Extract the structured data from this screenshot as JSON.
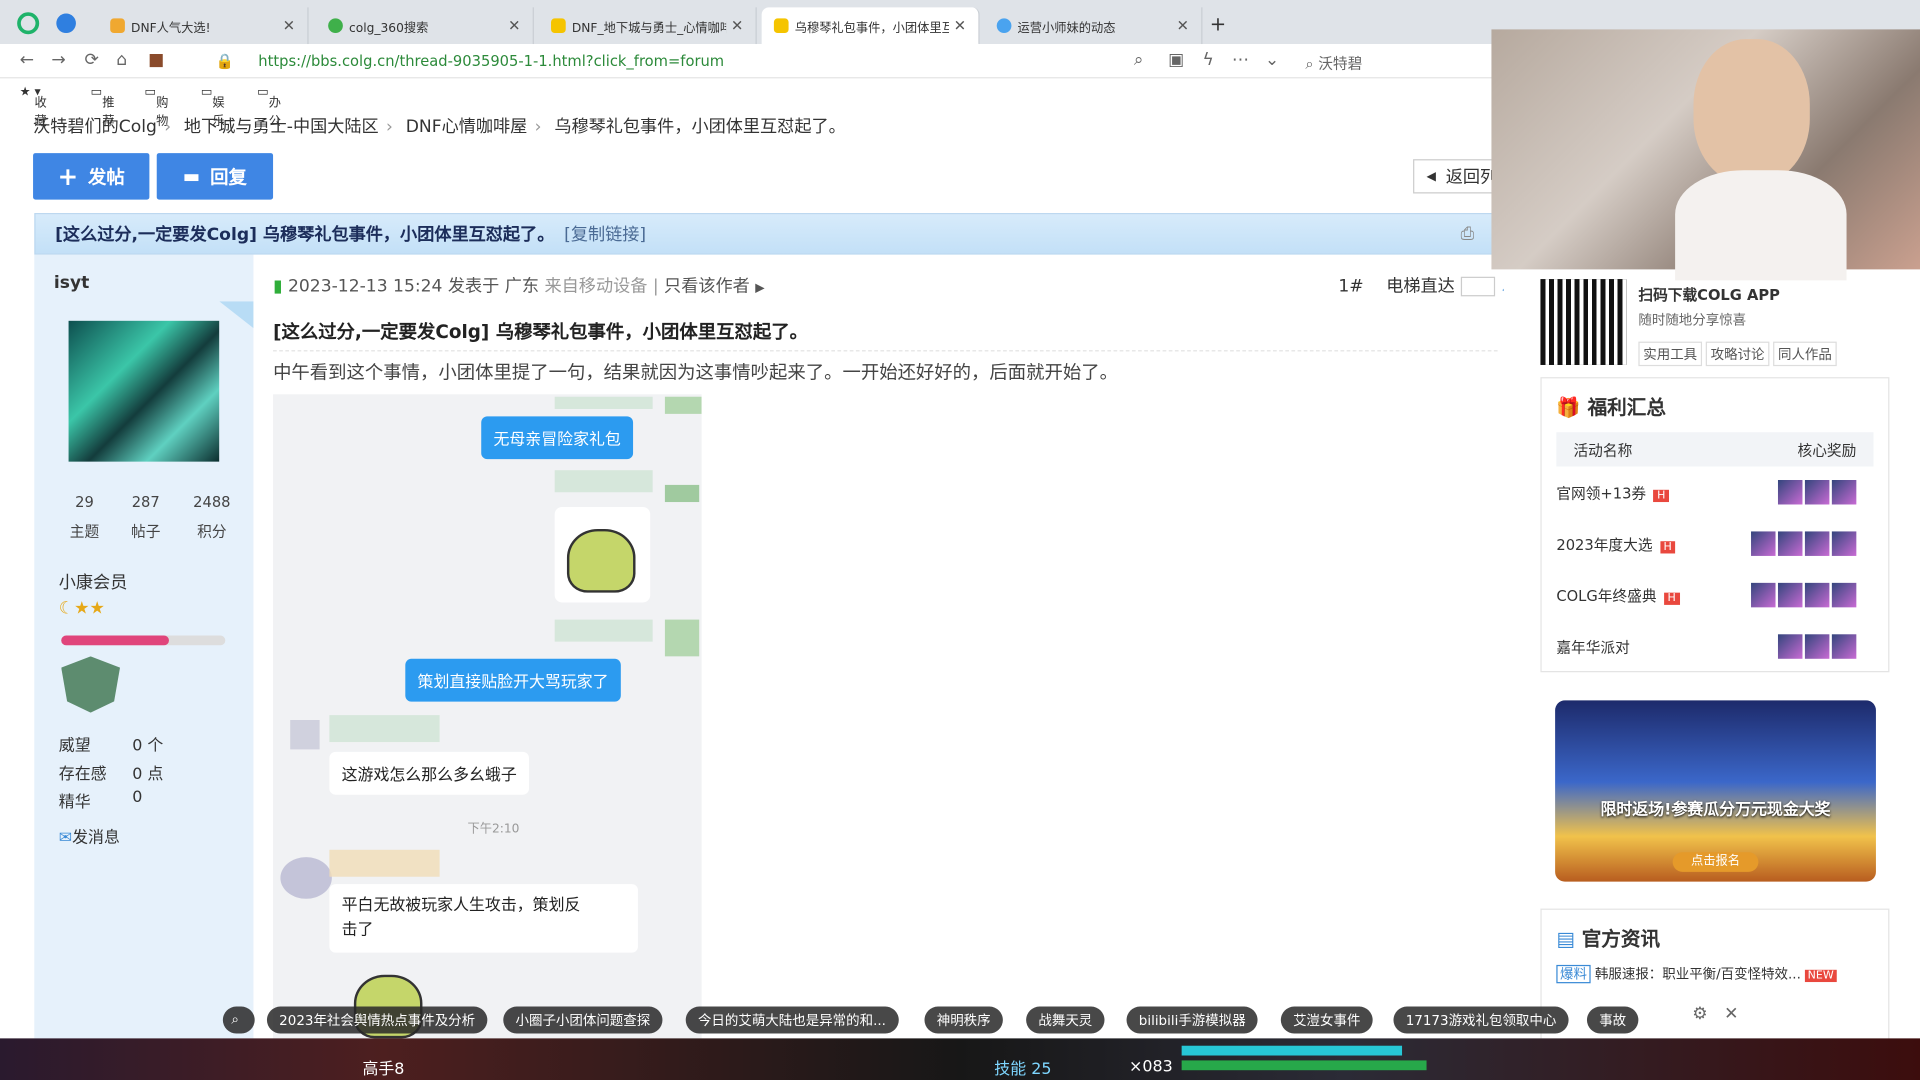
{
  "browser": {
    "tabs": [
      {
        "title": "DNF人气大选!",
        "active": false
      },
      {
        "title": "colg_360搜索",
        "active": false
      },
      {
        "title": "DNF_地下城与勇士_心情咖啡屋",
        "active": false
      },
      {
        "title": "乌穆琴礼包事件，小团体里互",
        "active": true
      },
      {
        "title": "运营小师妹的动态",
        "active": false
      }
    ],
    "url": "https://bbs.colg.cn/thread-9035905-1-1.html?click_from=forum",
    "search_text": "沃特碧",
    "bookmarks": [
      "收藏",
      "推荐",
      "购物",
      "娱乐",
      "办公"
    ]
  },
  "breadcrumb": [
    "沃特碧们的Colg",
    "地下城与勇士-中国大陆区",
    "DNF心情咖啡屋",
    "乌穆琴礼包事件，小团体里互怼起了。"
  ],
  "buttons": {
    "post": "发帖",
    "reply": "回复",
    "back": "返回列"
  },
  "thread": {
    "title_bar": "[这么过分,一定要发Colg] 乌穆琴礼包事件，小团体里互怼起了。",
    "copy_link": "[复制链接]",
    "meta_date": "2023-12-13 15:24 发表于 广东",
    "meta_device": "来自移动设备",
    "only_author": "只看该作者",
    "floor": "1#",
    "elevator": "电梯直达",
    "post_title": "[这么过分,一定要发Colg] 乌穆琴礼包事件，小团体里互怼起了。",
    "post_body": "中午看到这个事情，小团体里提了一句，结果就因为这事情吵起来了。一开始还好好的，后面就开始了。",
    "chat": {
      "msg1": "无母亲冒险家礼包",
      "msg2": "策划直接贴脸开大骂玩家了",
      "msg3": "这游戏怎么那么多幺蛾子",
      "time": "下午2:10",
      "msg4_line1": "平白无故被玩家人生攻击，策划反",
      "msg4_line2": "击了"
    }
  },
  "user": {
    "name": "isyt",
    "stats": [
      {
        "value": "29",
        "label": "主题"
      },
      {
        "value": "287",
        "label": "帖子"
      },
      {
        "value": "2488",
        "label": "积分"
      }
    ],
    "level": "小康会员",
    "level_progress": 0.66,
    "props": [
      {
        "label": "威望",
        "value": "0 个"
      },
      {
        "label": "存在感",
        "value": "0 点"
      },
      {
        "label": "精华",
        "value": "0"
      }
    ],
    "message": "发消息"
  },
  "sidebar": {
    "app_title": "扫码下载COLG APP",
    "app_sub": "随时随地分享惊喜",
    "app_tags": [
      "实用工具",
      "攻略讨论",
      "同人作品"
    ],
    "welfare_title": "福利汇总",
    "welfare_headers": [
      "活动名称",
      "核心奖励"
    ],
    "welfare_rows": [
      {
        "name": "官网领+13券",
        "hot": true
      },
      {
        "name": "2023年度大选",
        "hot": true
      },
      {
        "name": "COLG年终盛典",
        "hot": true
      },
      {
        "name": "嘉年华派对",
        "hot": false
      }
    ],
    "hot_mark": "H",
    "banner_text": "限时返场!参赛瓜分万元现金大奖",
    "banner_btn": "点击报名",
    "news_title": "官方资讯",
    "news_tag": "爆料",
    "news_item": "韩服速报：职业平衡/百变怪特效...",
    "news_new": "NEW"
  },
  "bottom_pills": [
    "2023年社会舆情热点事件及分析",
    "小圈子小团体问题查探",
    "今日的艾萌大陆也是异常的和...",
    "神明秩序",
    "战舞天灵",
    "bilibili手游模拟器",
    "艾溰女事件",
    "17173游戏礼包领取中心",
    "事故"
  ],
  "game_hud": {
    "left_text": "高手8",
    "skill": "技能 25",
    "count": "×083"
  }
}
